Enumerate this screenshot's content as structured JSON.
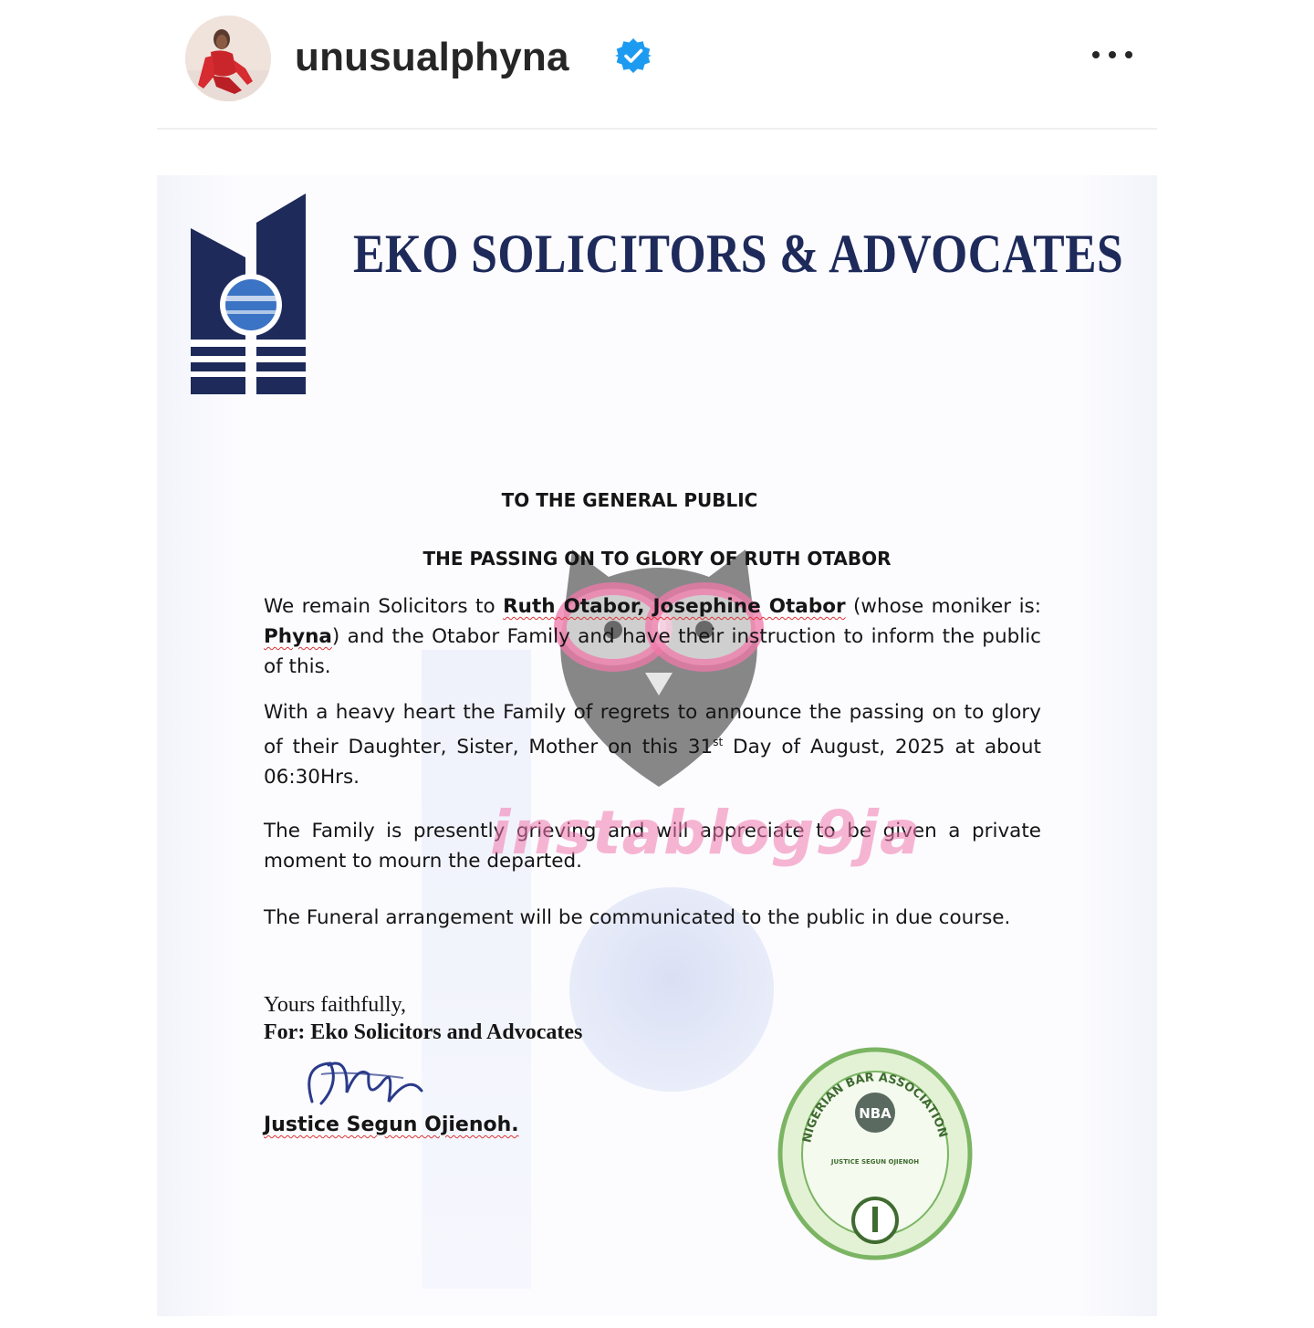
{
  "post": {
    "username": "unusualphyna",
    "verified_icon": "verified-badge-icon",
    "more_icon": "more-options-icon",
    "accent_color": "#1877f2"
  },
  "document": {
    "firm_name": "EKO SOLICITORS & ADVOCATES",
    "heading_1": "TO THE GENERAL PUBLIC",
    "heading_2": "THE PASSING ON TO GLORY OF RUTH OTABOR",
    "p1_a": "We remain Solicitors to ",
    "p1_b": "Ruth Otabor, Josephine Otabor",
    "p1_c": " (whose moniker is: ",
    "p1_d": "Phyna",
    "p1_e": ") and the Otabor Family and have their instruction to inform the public of this.",
    "p2_a": "With a heavy heart the Family of regrets to announce the passing on to glory of their Daughter, Sister, Mother on this 31",
    "p2_sup": "st",
    "p2_b": " Day of August, 2025 at about 06:30Hrs.",
    "p3": "The Family is presently grieving and will appreciate to be given a private moment to mourn the departed.",
    "p4": "The Funeral arrangement will be communicated to the public in due course.",
    "closing_1": "Yours faithfully,",
    "closing_2": "For: Eko Solicitors and Advocates",
    "signatory": "Justice Segun Ojienoh.",
    "seal_top": "NIGERIAN BAR ASSOCIATION",
    "seal_center": "NBA",
    "seal_name": "JUSTICE SEGUN OJIENOH",
    "watermark": "instablog9ja"
  }
}
